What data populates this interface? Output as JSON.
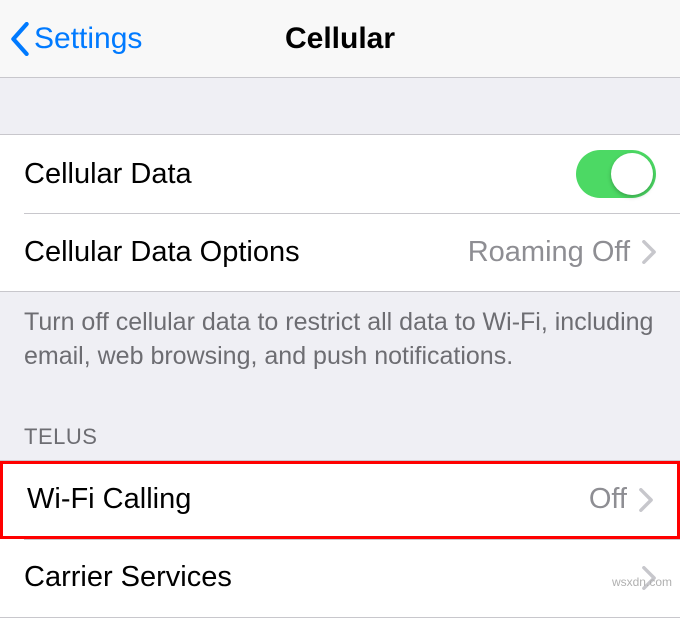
{
  "nav": {
    "back_label": "Settings",
    "title": "Cellular"
  },
  "cellular": {
    "data_label": "Cellular Data",
    "data_on": true,
    "options_label": "Cellular Data Options",
    "options_value": "Roaming Off",
    "footer": "Turn off cellular data to restrict all data to Wi-Fi, including email, web browsing, and push notifications."
  },
  "carrier": {
    "header": "TELUS",
    "wifi_calling_label": "Wi-Fi Calling",
    "wifi_calling_value": "Off",
    "services_label": "Carrier Services"
  },
  "watermark": "wsxdn.com"
}
